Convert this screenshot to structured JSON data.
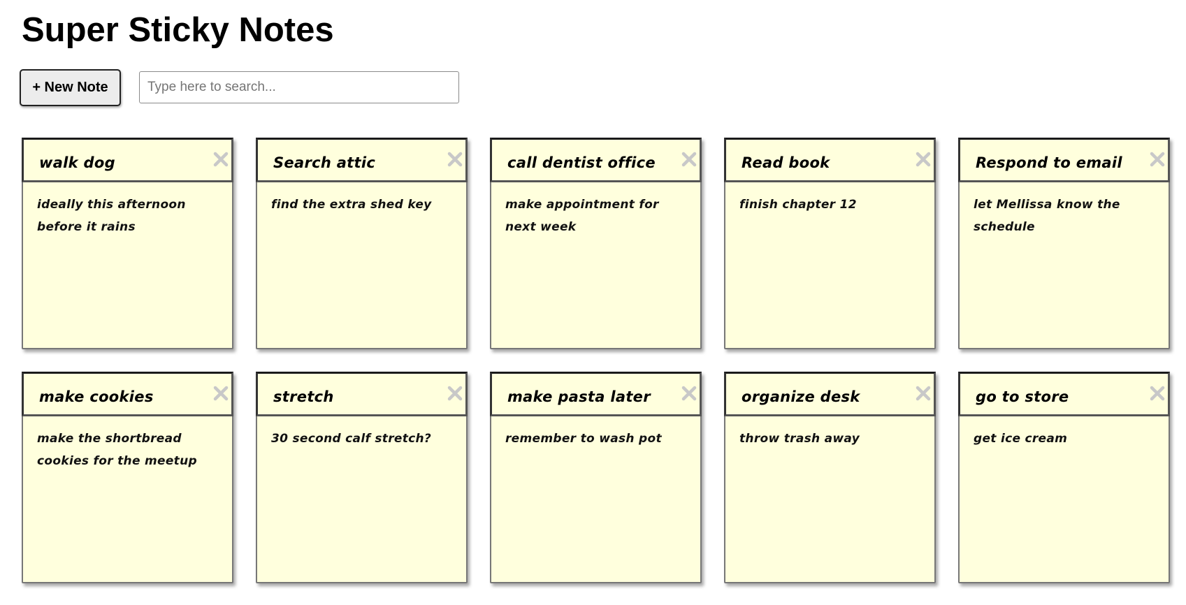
{
  "app": {
    "title": "Super Sticky Notes"
  },
  "toolbar": {
    "new_note_label": "+ New Note",
    "search_placeholder": "Type here to search...",
    "search_value": ""
  },
  "icons": {
    "close": "close-icon"
  },
  "colors": {
    "note_background": "#ffffdd",
    "close_icon": "#c8c8c8"
  },
  "notes": [
    {
      "title": "walk dog",
      "body": "ideally this afternoon before it rains"
    },
    {
      "title": "Search attic",
      "body": "find the extra shed key"
    },
    {
      "title": "call dentist office",
      "body": "make appointment for next week"
    },
    {
      "title": "Read book",
      "body": "finish chapter 12"
    },
    {
      "title": "Respond to email",
      "body": "let Mellissa know the schedule"
    },
    {
      "title": "make cookies",
      "body": "make the shortbread cookies for the meetup"
    },
    {
      "title": "stretch",
      "body": "30 second calf stretch?"
    },
    {
      "title": "make pasta later",
      "body": "remember to wash pot"
    },
    {
      "title": "organize desk",
      "body": "throw trash away"
    },
    {
      "title": "go to store",
      "body": "get ice cream"
    }
  ]
}
